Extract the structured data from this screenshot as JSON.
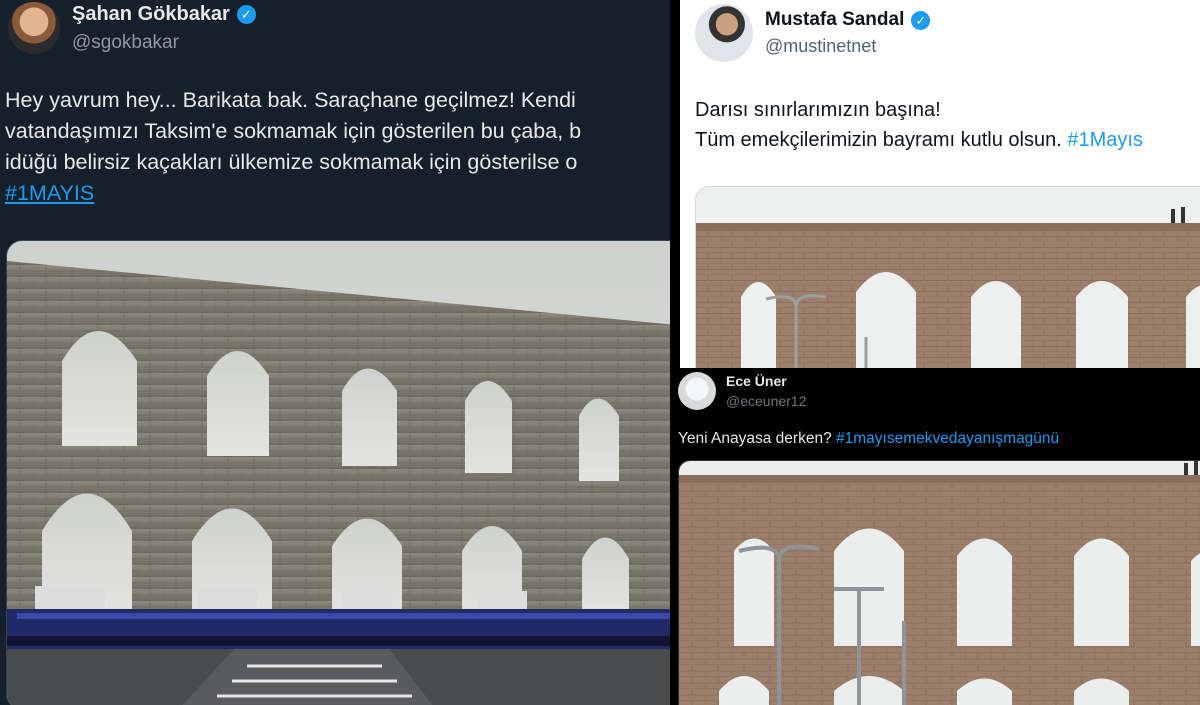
{
  "tweets": [
    {
      "display_name": "Şahan Gökbakar",
      "handle": "@sgokbakar",
      "verified": true,
      "lines": [
        "Hey yavrum hey... Barikata bak.  Saraçhane geçilmez! Kendi",
        "vatandaşımızı Taksim'e sokmamak için gösterilen bu çaba, b",
        "idüğü belirsiz kaçakları ülkemize sokmamak için gösterilse o"
      ],
      "hashtag": "#1MAYIS"
    },
    {
      "display_name": "Mustafa Sandal",
      "handle": "@mustinetnet",
      "verified": true,
      "line1": "Darısı sınırlarımızın başına!",
      "line2": "Tüm emekçilerimizin bayramı kutlu olsun.",
      "hashtag": "#1Mayıs"
    },
    {
      "display_name": "Ece Üner",
      "handle": "@eceuner12",
      "verified": false,
      "text": "Yeni Anayasa derken?",
      "hashtag": "#1mayısemekvedayanışmagünü"
    }
  ],
  "colors": {
    "dark_bg": "#15202b",
    "black_bg": "#000000",
    "light_bg": "#ffffff",
    "link_blue": "#1d9bf0",
    "verified_blue": "#1d9bf0"
  },
  "icons": {
    "verified": "verified-badge-icon"
  }
}
